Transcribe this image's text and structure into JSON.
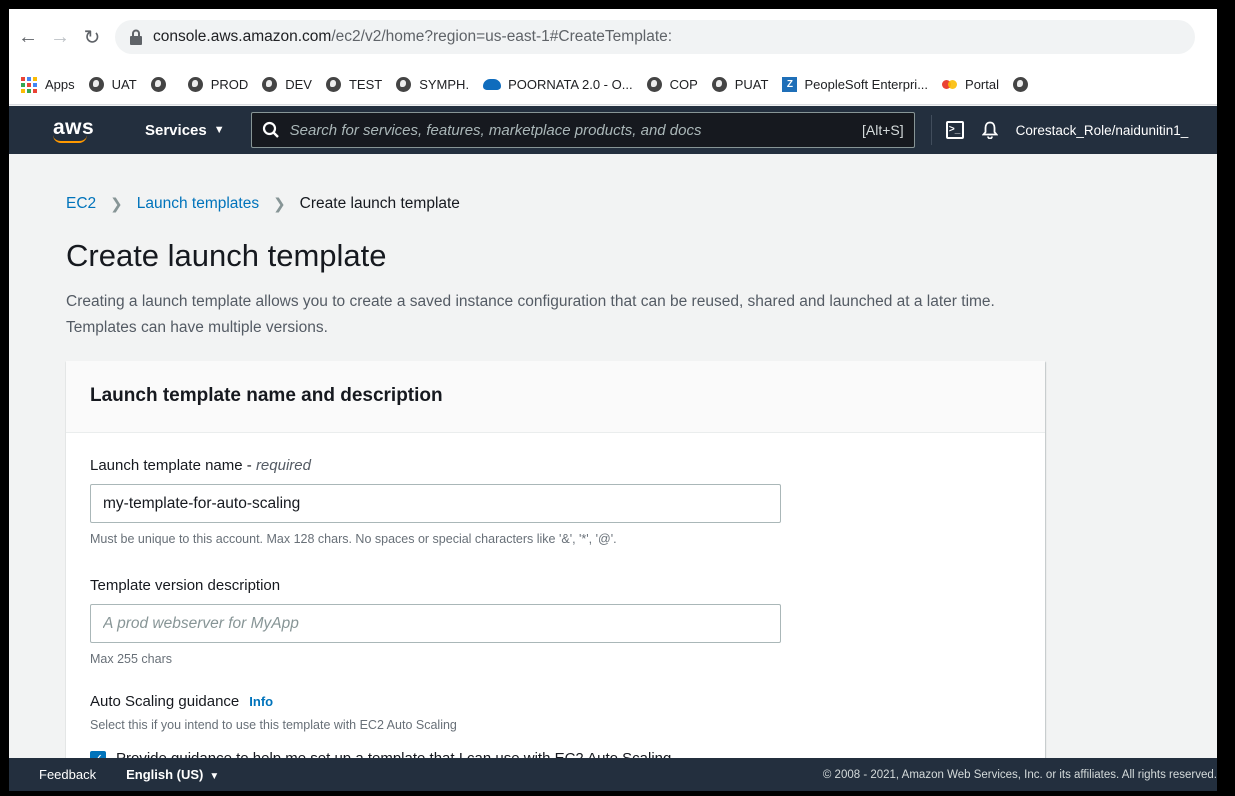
{
  "browser": {
    "url_host": "console.aws.amazon.com",
    "url_rest": "/ec2/v2/home?region=us-east-1#CreateTemplate:",
    "bookmarks": [
      {
        "label": "Apps",
        "icon": "apps-grid-icon"
      },
      {
        "label": "UAT",
        "icon": "globe-icon"
      },
      {
        "label": "",
        "icon": "globe-icon"
      },
      {
        "label": "PROD",
        "icon": "globe-icon"
      },
      {
        "label": "DEV",
        "icon": "globe-icon"
      },
      {
        "label": "TEST",
        "icon": "globe-icon"
      },
      {
        "label": "SYMPH.",
        "icon": "globe-icon"
      },
      {
        "label": "POORNATA 2.0 - O...",
        "icon": "cloud-icon"
      },
      {
        "label": "COP",
        "icon": "globe-icon"
      },
      {
        "label": "PUAT",
        "icon": "globe-icon"
      },
      {
        "label": "PeopleSoft Enterpri...",
        "icon": "peoplesoft-icon"
      },
      {
        "label": "Portal",
        "icon": "portal-icon"
      }
    ]
  },
  "aws_nav": {
    "logo": "aws",
    "services_label": "Services",
    "search_placeholder": "Search for services, features, marketplace products, and docs",
    "search_shortcut": "[Alt+S]",
    "role": "Corestack_Role/naidunitin1_"
  },
  "breadcrumb": {
    "root": "EC2",
    "parent": "Launch templates",
    "current": "Create launch template"
  },
  "page": {
    "title": "Create launch template",
    "description": "Creating a launch template allows you to create a saved instance configuration that can be reused, shared and launched at a later time. Templates can have multiple versions."
  },
  "panel": {
    "title": "Launch template name and description",
    "name_label": "Launch template name - ",
    "name_required": "required",
    "name_value": "my-template-for-auto-scaling",
    "name_hint": "Must be unique to this account. Max 128 chars. No spaces or special characters like '&', '*', '@'.",
    "desc_label": "Template version description",
    "desc_placeholder": "A prod webserver for MyApp",
    "desc_hint": "Max 255 chars",
    "asg_label": "Auto Scaling guidance",
    "asg_info": "Info",
    "asg_hint": "Select this if you intend to use this template with EC2 Auto Scaling",
    "asg_checkbox_label": "Provide guidance to help me set up a template that I can use with EC2 Auto Scaling",
    "asg_checked": true
  },
  "footer": {
    "feedback": "Feedback",
    "language": "English (US)",
    "copyright": "© 2008 - 2021, Amazon Web Services, Inc. or its affiliates. All rights reserved."
  },
  "colors": {
    "aws_nav_bg": "#232f3e",
    "aws_orange": "#ff9900",
    "link_blue": "#0073bb"
  }
}
